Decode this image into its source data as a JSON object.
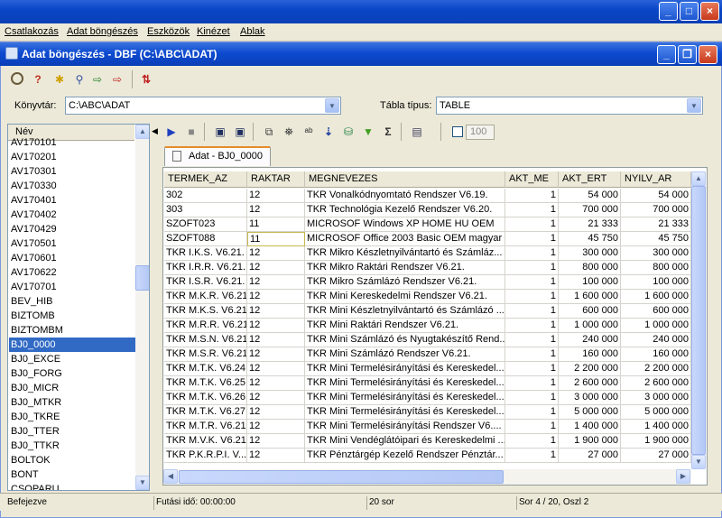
{
  "outer_window": {
    "buttons": [
      "_",
      "□",
      "×"
    ]
  },
  "menubar": [
    {
      "label": "Csatlakozás"
    },
    {
      "label": "Adat böngészés"
    },
    {
      "label": "Eszközök"
    },
    {
      "label": "Kinézet"
    },
    {
      "label": "Ablak"
    }
  ],
  "inner_window": {
    "title": "Adat böngészés - DBF (C:\\ABC\\ADAT)",
    "buttons": [
      "_",
      "❐",
      "×"
    ]
  },
  "toolbar_icons": [
    "search-icon",
    "query-icon",
    "new-icon",
    "tree-icon",
    "connect-icon",
    "disconnect-icon",
    "sync-icon"
  ],
  "konyvtar": {
    "label": "Könyvtár:",
    "value": "C:\\ABC\\ADAT"
  },
  "tabla_tipus": {
    "label": "Tábla típus:",
    "value": "TABLE"
  },
  "list": {
    "header": "Név",
    "items": [
      "AV170101",
      "AV170201",
      "AV170301",
      "AV170330",
      "AV170401",
      "AV170402",
      "AV170429",
      "AV170501",
      "AV170601",
      "AV170622",
      "AV170701",
      "BEV_HIB",
      "BIZTOMB",
      "BIZTOMBM",
      "BJ0_0000",
      "BJ0_EXCE",
      "BJ0_FORG",
      "BJ0_MICR",
      "BJ0_MTKR",
      "BJ0_TKRE",
      "BJ0_TTER",
      "BJ0_TTKR",
      "BOLTOK",
      "BONT",
      "CSOPARU"
    ],
    "selected_index": 14
  },
  "grid_toolbar": {
    "limit_value": "100"
  },
  "tab": {
    "label": "Adat - BJ0_0000"
  },
  "grid": {
    "columns": [
      "TERMEK_AZ",
      "RAKTAR",
      "MEGNEVEZES",
      "AKT_ME",
      "AKT_ERT",
      "NYILV_AR"
    ],
    "rows": [
      [
        "302",
        "12",
        "TKR Vonalkódnyomtató Rendszer V6.19.",
        "1",
        "54 000",
        "54 000"
      ],
      [
        "303",
        "12",
        "TKR Technológia Kezelő Rendszer V6.20.",
        "1",
        "700 000",
        "700 000"
      ],
      [
        "SZOFT023",
        "11",
        "MICROSOF Windows XP HOME HU OEM",
        "1",
        "21 333",
        "21 333"
      ],
      [
        "SZOFT088",
        "11",
        "MICROSOF Office 2003 Basic OEM magyar",
        "1",
        "45 750",
        "45 750"
      ],
      [
        "TKR I.K.S. V6.21.",
        "12",
        "TKR Mikro Készletnyilvántartó és Számláz...",
        "1",
        "300 000",
        "300 000"
      ],
      [
        "TKR I.R.R. V6.21.",
        "12",
        "TKR Mikro Raktári Rendszer V6.21.",
        "1",
        "800 000",
        "800 000"
      ],
      [
        "TKR I.S.R. V6.21.",
        "12",
        "TKR Mikro Számlázó Rendszer V6.21.",
        "1",
        "100 000",
        "100 000"
      ],
      [
        "TKR M.K.R. V6.21.",
        "12",
        "TKR Mini Kereskedelmi Rendszer V6.21.",
        "1",
        "1 600 000",
        "1 600 000"
      ],
      [
        "TKR M.K.S. V6.21.",
        "12",
        "TKR Mini Készletnyilvántartó és Számlázó ...",
        "1",
        "600 000",
        "600 000"
      ],
      [
        "TKR M.R.R. V6.21.",
        "12",
        "TKR Mini Raktári Rendszer V6.21.",
        "1",
        "1 000 000",
        "1 000 000"
      ],
      [
        "TKR M.S.N. V6.21.",
        "12",
        "TKR Mini Számlázó és Nyugtakészítő Rend...",
        "1",
        "240 000",
        "240 000"
      ],
      [
        "TKR M.S.R. V6.21.",
        "12",
        "TKR Mini Számlázó Rendszer V6.21.",
        "1",
        "160 000",
        "160 000"
      ],
      [
        "TKR M.T.K. V6.24.",
        "12",
        "TKR Mini Termelésirányítási és Kereskedel...",
        "1",
        "2 200 000",
        "2 200 000"
      ],
      [
        "TKR M.T.K. V6.25.",
        "12",
        "TKR Mini Termelésirányítási és Kereskedel...",
        "1",
        "2 600 000",
        "2 600 000"
      ],
      [
        "TKR M.T.K. V6.26.",
        "12",
        "TKR Mini Termelésirányítási és Kereskedel...",
        "1",
        "3 000 000",
        "3 000 000"
      ],
      [
        "TKR M.T.K. V6.27.",
        "12",
        "TKR Mini Termelésirányítási és Kereskedel...",
        "1",
        "5 000 000",
        "5 000 000"
      ],
      [
        "TKR M.T.R. V6.21.",
        "12",
        "TKR Mini Termelésirányítási Rendszer V6....",
        "1",
        "1 400 000",
        "1 400 000"
      ],
      [
        "TKR M.V.K. V6.21.",
        "12",
        "TKR Mini Vendéglátóipari és Kereskedelmi ...",
        "1",
        "1 900 000",
        "1 900 000"
      ],
      [
        "TKR P.K.R.P.I. V...",
        "12",
        "TKR Pénztárgép Kezelő Rendszer Pénztár...",
        "1",
        "27 000",
        "27 000"
      ]
    ]
  },
  "status": {
    "state": "Befejezve",
    "runtime": "Futási idő: 00:00:00",
    "rows": "20 sor",
    "position": "Sor 4 / 20, Oszl 2"
  }
}
